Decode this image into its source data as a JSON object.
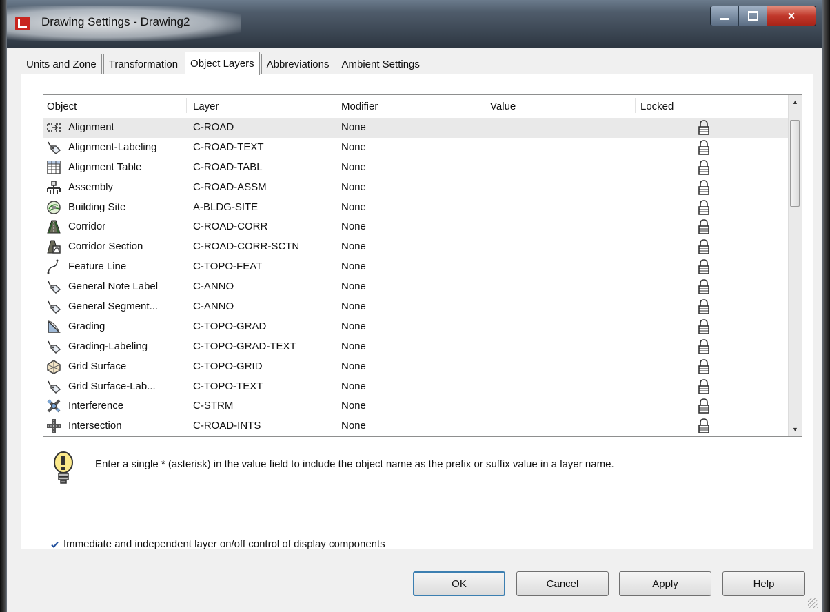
{
  "window": {
    "title": "Drawing Settings - Drawing2"
  },
  "tabs": [
    {
      "label": "Units and Zone",
      "active": false
    },
    {
      "label": "Transformation",
      "active": false
    },
    {
      "label": "Object Layers",
      "active": true
    },
    {
      "label": "Abbreviations",
      "active": false
    },
    {
      "label": "Ambient Settings",
      "active": false
    }
  ],
  "table": {
    "columns": {
      "object": "Object",
      "layer": "Layer",
      "modifier": "Modifier",
      "value": "Value",
      "locked": "Locked"
    },
    "rows": [
      {
        "icon": "alignment-icon",
        "object": "Alignment",
        "layer": "C-ROAD",
        "modifier": "None",
        "value": "",
        "locked": true
      },
      {
        "icon": "label-tag-icon",
        "object": "Alignment-Labeling",
        "layer": "C-ROAD-TEXT",
        "modifier": "None",
        "value": "",
        "locked": true
      },
      {
        "icon": "table-icon",
        "object": "Alignment Table",
        "layer": "C-ROAD-TABL",
        "modifier": "None",
        "value": "",
        "locked": true
      },
      {
        "icon": "assembly-icon",
        "object": "Assembly",
        "layer": "C-ROAD-ASSM",
        "modifier": "None",
        "value": "",
        "locked": true
      },
      {
        "icon": "building-site-icon",
        "object": "Building Site",
        "layer": "A-BLDG-SITE",
        "modifier": "None",
        "value": "",
        "locked": true
      },
      {
        "icon": "corridor-icon",
        "object": "Corridor",
        "layer": "C-ROAD-CORR",
        "modifier": "None",
        "value": "",
        "locked": true
      },
      {
        "icon": "corridor-section-icon",
        "object": "Corridor Section",
        "layer": "C-ROAD-CORR-SCTN",
        "modifier": "None",
        "value": "",
        "locked": true
      },
      {
        "icon": "feature-line-icon",
        "object": "Feature Line",
        "layer": "C-TOPO-FEAT",
        "modifier": "None",
        "value": "",
        "locked": true
      },
      {
        "icon": "label-tag-icon",
        "object": "General Note Label",
        "layer": "C-ANNO",
        "modifier": "None",
        "value": "",
        "locked": true
      },
      {
        "icon": "label-tag-icon",
        "object": "General Segment...",
        "layer": "C-ANNO",
        "modifier": "None",
        "value": "",
        "locked": true
      },
      {
        "icon": "grading-icon",
        "object": "Grading",
        "layer": "C-TOPO-GRAD",
        "modifier": "None",
        "value": "",
        "locked": true
      },
      {
        "icon": "label-tag-icon",
        "object": "Grading-Labeling",
        "layer": "C-TOPO-GRAD-TEXT",
        "modifier": "None",
        "value": "",
        "locked": true
      },
      {
        "icon": "grid-surface-icon",
        "object": "Grid Surface",
        "layer": "C-TOPO-GRID",
        "modifier": "None",
        "value": "",
        "locked": true
      },
      {
        "icon": "label-tag-icon",
        "object": "Grid Surface-Lab...",
        "layer": "C-TOPO-TEXT",
        "modifier": "None",
        "value": "",
        "locked": true
      },
      {
        "icon": "interference-icon",
        "object": "Interference",
        "layer": "C-STRM",
        "modifier": "None",
        "value": "",
        "locked": true
      },
      {
        "icon": "intersection-icon",
        "object": "Intersection",
        "layer": "C-ROAD-INTS",
        "modifier": "None",
        "value": "",
        "locked": true
      }
    ]
  },
  "hint": {
    "icon": "lightbulb-icon",
    "text": "Enter a single * (asterisk) in the value field to include the object name as the prefix or suffix value in a layer name."
  },
  "checkbox": {
    "label": "Immediate and independent layer on/off control of display components",
    "checked": true
  },
  "buttons": {
    "ok": "OK",
    "cancel": "Cancel",
    "apply": "Apply",
    "help": "Help"
  },
  "colors": {
    "titlebar": "#3b4756",
    "close_button": "#c0382b",
    "default_button_border": "#3c7fb1",
    "selected_row": "#e9e9e9"
  }
}
